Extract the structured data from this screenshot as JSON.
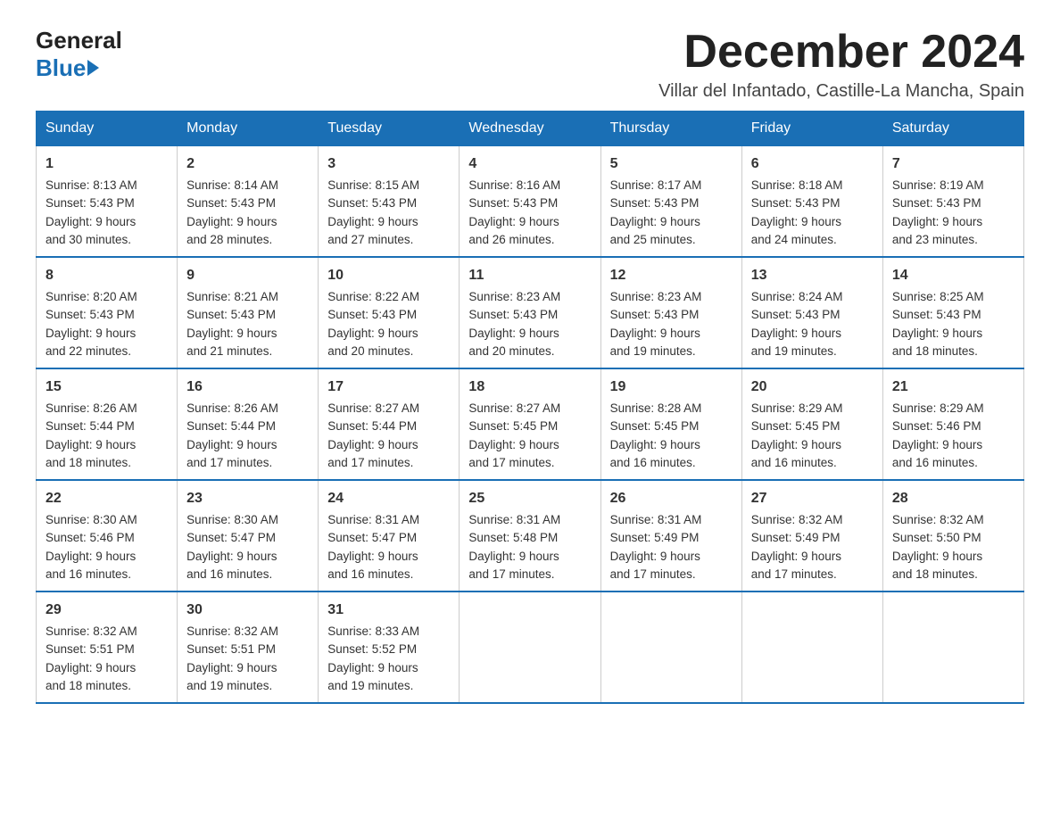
{
  "logo": {
    "line1": "General",
    "line2": "Blue"
  },
  "title": {
    "month_year": "December 2024",
    "location": "Villar del Infantado, Castille-La Mancha, Spain"
  },
  "weekdays": [
    "Sunday",
    "Monday",
    "Tuesday",
    "Wednesday",
    "Thursday",
    "Friday",
    "Saturday"
  ],
  "weeks": [
    [
      {
        "day": "1",
        "sunrise": "8:13 AM",
        "sunset": "5:43 PM",
        "daylight": "9 hours and 30 minutes."
      },
      {
        "day": "2",
        "sunrise": "8:14 AM",
        "sunset": "5:43 PM",
        "daylight": "9 hours and 28 minutes."
      },
      {
        "day": "3",
        "sunrise": "8:15 AM",
        "sunset": "5:43 PM",
        "daylight": "9 hours and 27 minutes."
      },
      {
        "day": "4",
        "sunrise": "8:16 AM",
        "sunset": "5:43 PM",
        "daylight": "9 hours and 26 minutes."
      },
      {
        "day": "5",
        "sunrise": "8:17 AM",
        "sunset": "5:43 PM",
        "daylight": "9 hours and 25 minutes."
      },
      {
        "day": "6",
        "sunrise": "8:18 AM",
        "sunset": "5:43 PM",
        "daylight": "9 hours and 24 minutes."
      },
      {
        "day": "7",
        "sunrise": "8:19 AM",
        "sunset": "5:43 PM",
        "daylight": "9 hours and 23 minutes."
      }
    ],
    [
      {
        "day": "8",
        "sunrise": "8:20 AM",
        "sunset": "5:43 PM",
        "daylight": "9 hours and 22 minutes."
      },
      {
        "day": "9",
        "sunrise": "8:21 AM",
        "sunset": "5:43 PM",
        "daylight": "9 hours and 21 minutes."
      },
      {
        "day": "10",
        "sunrise": "8:22 AM",
        "sunset": "5:43 PM",
        "daylight": "9 hours and 20 minutes."
      },
      {
        "day": "11",
        "sunrise": "8:23 AM",
        "sunset": "5:43 PM",
        "daylight": "9 hours and 20 minutes."
      },
      {
        "day": "12",
        "sunrise": "8:23 AM",
        "sunset": "5:43 PM",
        "daylight": "9 hours and 19 minutes."
      },
      {
        "day": "13",
        "sunrise": "8:24 AM",
        "sunset": "5:43 PM",
        "daylight": "9 hours and 19 minutes."
      },
      {
        "day": "14",
        "sunrise": "8:25 AM",
        "sunset": "5:43 PM",
        "daylight": "9 hours and 18 minutes."
      }
    ],
    [
      {
        "day": "15",
        "sunrise": "8:26 AM",
        "sunset": "5:44 PM",
        "daylight": "9 hours and 18 minutes."
      },
      {
        "day": "16",
        "sunrise": "8:26 AM",
        "sunset": "5:44 PM",
        "daylight": "9 hours and 17 minutes."
      },
      {
        "day": "17",
        "sunrise": "8:27 AM",
        "sunset": "5:44 PM",
        "daylight": "9 hours and 17 minutes."
      },
      {
        "day": "18",
        "sunrise": "8:27 AM",
        "sunset": "5:45 PM",
        "daylight": "9 hours and 17 minutes."
      },
      {
        "day": "19",
        "sunrise": "8:28 AM",
        "sunset": "5:45 PM",
        "daylight": "9 hours and 16 minutes."
      },
      {
        "day": "20",
        "sunrise": "8:29 AM",
        "sunset": "5:45 PM",
        "daylight": "9 hours and 16 minutes."
      },
      {
        "day": "21",
        "sunrise": "8:29 AM",
        "sunset": "5:46 PM",
        "daylight": "9 hours and 16 minutes."
      }
    ],
    [
      {
        "day": "22",
        "sunrise": "8:30 AM",
        "sunset": "5:46 PM",
        "daylight": "9 hours and 16 minutes."
      },
      {
        "day": "23",
        "sunrise": "8:30 AM",
        "sunset": "5:47 PM",
        "daylight": "9 hours and 16 minutes."
      },
      {
        "day": "24",
        "sunrise": "8:31 AM",
        "sunset": "5:47 PM",
        "daylight": "9 hours and 16 minutes."
      },
      {
        "day": "25",
        "sunrise": "8:31 AM",
        "sunset": "5:48 PM",
        "daylight": "9 hours and 17 minutes."
      },
      {
        "day": "26",
        "sunrise": "8:31 AM",
        "sunset": "5:49 PM",
        "daylight": "9 hours and 17 minutes."
      },
      {
        "day": "27",
        "sunrise": "8:32 AM",
        "sunset": "5:49 PM",
        "daylight": "9 hours and 17 minutes."
      },
      {
        "day": "28",
        "sunrise": "8:32 AM",
        "sunset": "5:50 PM",
        "daylight": "9 hours and 18 minutes."
      }
    ],
    [
      {
        "day": "29",
        "sunrise": "8:32 AM",
        "sunset": "5:51 PM",
        "daylight": "9 hours and 18 minutes."
      },
      {
        "day": "30",
        "sunrise": "8:32 AM",
        "sunset": "5:51 PM",
        "daylight": "9 hours and 19 minutes."
      },
      {
        "day": "31",
        "sunrise": "8:33 AM",
        "sunset": "5:52 PM",
        "daylight": "9 hours and 19 minutes."
      },
      null,
      null,
      null,
      null
    ]
  ],
  "labels": {
    "sunrise": "Sunrise:",
    "sunset": "Sunset:",
    "daylight": "Daylight:"
  }
}
